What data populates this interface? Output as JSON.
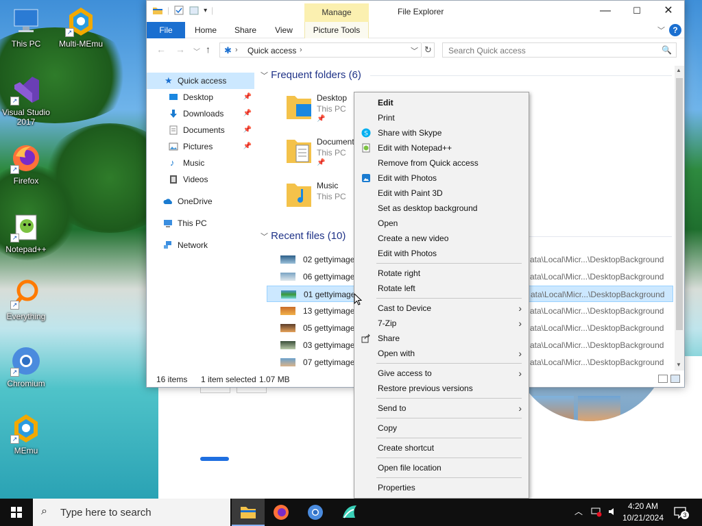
{
  "desktop": {
    "icons": [
      {
        "label": "This PC"
      },
      {
        "label": "Multi-MEmu"
      },
      {
        "label": "Visual Studio 2017"
      },
      {
        "label": "Firefox"
      },
      {
        "label": "Notepad++"
      },
      {
        "label": "Everything"
      },
      {
        "label": "Chromium"
      },
      {
        "label": "MEmu"
      }
    ]
  },
  "explorer": {
    "title": "File Explorer",
    "manage_tab": "Manage",
    "ribbon_tabs": [
      "File",
      "Home",
      "Share",
      "View",
      "Picture Tools"
    ],
    "address": {
      "crumb": "Quick access"
    },
    "search_placeholder": "Search Quick access",
    "nav_items": [
      {
        "label": "Quick access",
        "icon": "star-icon"
      },
      {
        "label": "Desktop",
        "icon": "desktop-icon",
        "pinned": true
      },
      {
        "label": "Downloads",
        "icon": "download-icon",
        "pinned": true
      },
      {
        "label": "Documents",
        "icon": "documents-icon",
        "pinned": true
      },
      {
        "label": "Pictures",
        "icon": "pictures-icon",
        "pinned": true
      },
      {
        "label": "Music",
        "icon": "music-icon"
      },
      {
        "label": "Videos",
        "icon": "videos-icon"
      },
      {
        "label": "OneDrive",
        "icon": "cloud-icon"
      },
      {
        "label": "This PC",
        "icon": "computer-icon"
      },
      {
        "label": "Network",
        "icon": "network-icon"
      }
    ],
    "frequent_header": "Frequent folders (6)",
    "frequent": [
      {
        "name": "Desktop",
        "location": "This PC"
      },
      {
        "name": "Document",
        "location": "This PC"
      },
      {
        "name": "Music",
        "location": "This PC"
      }
    ],
    "recent_header": "Recent files (10)",
    "recent": [
      {
        "name": "02 gettyimage",
        "path": "ata\\Local\\Micr...\\DesktopBackground"
      },
      {
        "name": "06 gettyimage",
        "path": "ata\\Local\\Micr...\\DesktopBackground"
      },
      {
        "name": "01 gettyimage",
        "path": "ata\\Local\\Micr...\\DesktopBackground"
      },
      {
        "name": "13 gettyimage",
        "path": "ata\\Local\\Micr...\\DesktopBackground"
      },
      {
        "name": "05 gettyimage",
        "path": "ata\\Local\\Micr...\\DesktopBackground"
      },
      {
        "name": "03 gettyimage",
        "path": "ata\\Local\\Micr...\\DesktopBackground"
      },
      {
        "name": "07 gettyimage",
        "path": "ata\\Local\\Micr...\\DesktopBackground"
      }
    ],
    "status": {
      "items": "16 items",
      "selected": "1 item selected",
      "size": "1.07 MB"
    }
  },
  "context_menu": {
    "items": [
      "Edit",
      "Print",
      "Share with Skype",
      "Edit with Notepad++",
      "Remove from Quick access",
      "Edit with Photos",
      "Edit with Paint 3D",
      "Set as desktop background",
      "Open",
      "Create a new video",
      "Edit with Photos",
      "Rotate right",
      "Rotate left",
      "Cast to Device",
      "7-Zip",
      "Share",
      "Open with",
      "Give access to",
      "Restore previous versions",
      "Send to",
      "Copy",
      "Create shortcut",
      "Open file location",
      "Properties"
    ]
  },
  "background_window": {
    "progress": 0.09
  },
  "taskbar": {
    "search_placeholder": "Type here to search",
    "time": "4:20 AM",
    "date": "10/21/2024",
    "notification_count": "3"
  }
}
